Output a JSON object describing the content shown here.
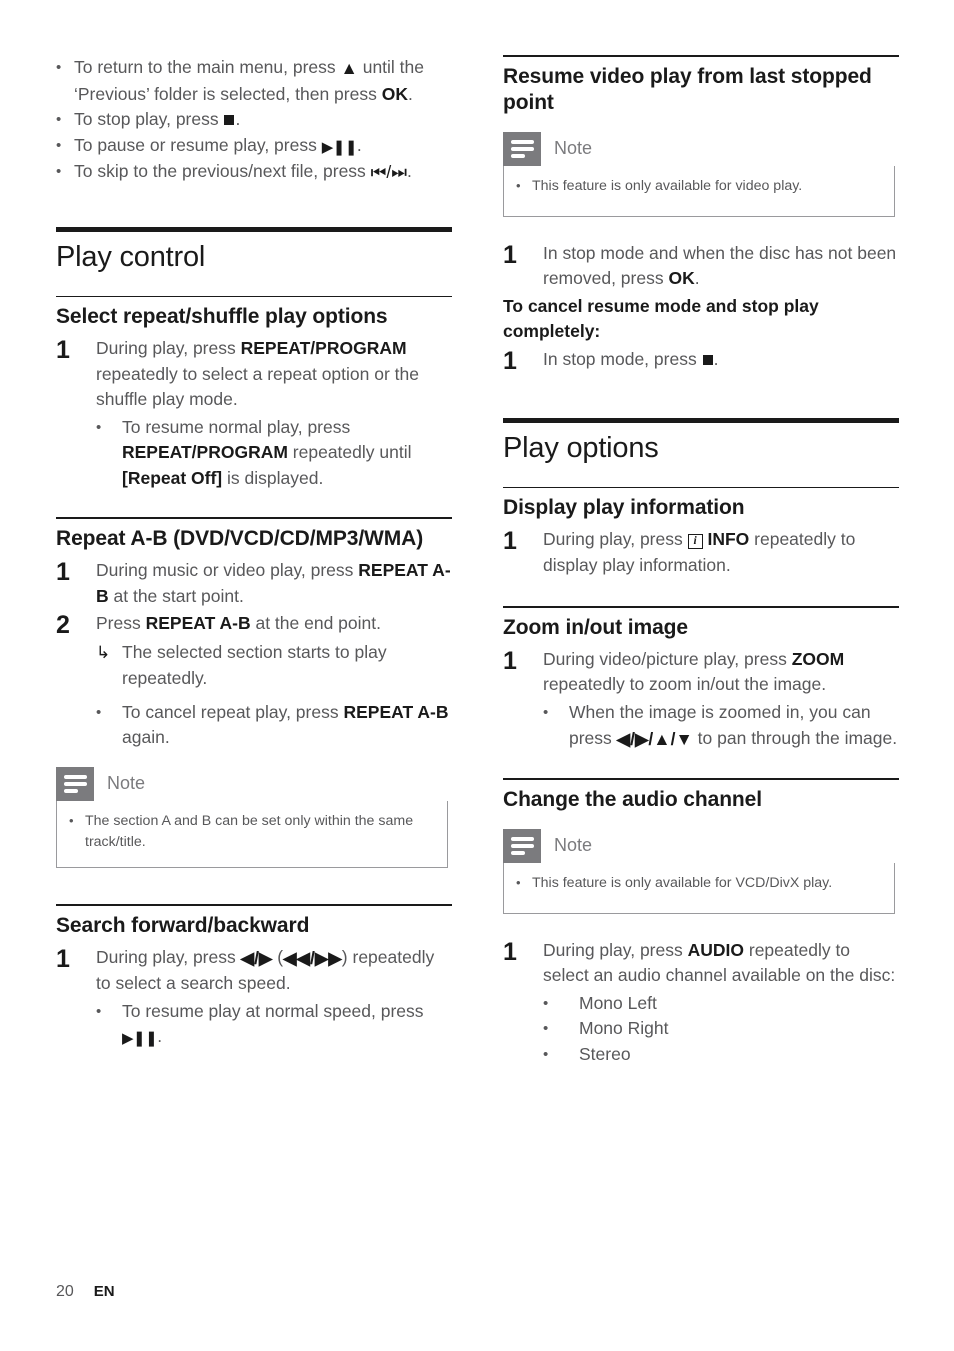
{
  "document": {
    "footer": {
      "page_number": "20",
      "language": "EN"
    },
    "note_label": "Note"
  },
  "left_column": {
    "intro_bullets": [
      {
        "prefix": "To return to the main menu, press ",
        "glyph": "up-arrow",
        "mid": " until the ‘Previous’ folder is selected, then press ",
        "bold": "OK",
        "suffix": "."
      },
      {
        "prefix": "To stop play, press ",
        "glyph": "stop",
        "suffix": "."
      },
      {
        "prefix": "To pause or resume play, press ",
        "glyph": "play-pause",
        "suffix": "."
      },
      {
        "prefix": "To skip to the previous/next file, press ",
        "glyph": "prev-next",
        "suffix": "."
      }
    ],
    "section": {
      "title": "Play control"
    },
    "sub_repeat_shuffle": {
      "title": "Select repeat/shuffle play options",
      "step_number": "1",
      "step_text_pre": "During play, press ",
      "step_bold": "REPEAT/PROGRAM",
      "step_text_post": " repeatedly to select a repeat option or the shuffle play mode.",
      "bullet_pre": "To resume normal play, press ",
      "bullet_bold": "REPEAT/PROGRAM",
      "bullet_mid": " repeatedly until ",
      "bullet_bold2": "[Repeat Off]",
      "bullet_post": " is displayed."
    },
    "sub_repeat_ab": {
      "title": "Repeat A-B (DVD/VCD/CD/MP3/WMA)",
      "step1_number": "1",
      "step1_pre": "During music or video play, press ",
      "step1_bold": "REPEAT A-B",
      "step1_post": " at the start point.",
      "step2_number": "2",
      "step2_pre": "Press ",
      "step2_bold": "REPEAT A-B",
      "step2_post": " at the end point.",
      "result": "The selected section starts to play repeatedly.",
      "bullet_pre": "To cancel repeat play, press ",
      "bullet_bold": "REPEAT A-B",
      "bullet_post": " again.",
      "note_bullet": "The section A and B can be set only within the same track/title."
    },
    "sub_search": {
      "title": "Search forward/backward",
      "step_number": "1",
      "step_pre": "During play, press ",
      "step_glyph1": "◀/▶",
      "step_mid": " (",
      "step_glyph2": "◀◀/▶▶",
      "step_post": ") repeatedly to select a search speed.",
      "bullet_pre": "To resume play at normal speed, press ",
      "bullet_glyph": "play-pause",
      "bullet_post": "."
    }
  },
  "right_column": {
    "sub_resume": {
      "title": "Resume video play from last stopped point",
      "note_bullet": "This feature is only available for video play.",
      "step1_number": "1",
      "step1_pre": "In stop mode and when the disc has not been removed, press ",
      "step1_bold": "OK",
      "step1_post": ".",
      "cancel_heading": "To cancel resume mode and stop play completely:",
      "step2_number": "1",
      "step2_pre": "In stop mode, press ",
      "step2_glyph": "stop",
      "step2_post": "."
    },
    "section": {
      "title": "Play options"
    },
    "sub_display_info": {
      "title": "Display play information",
      "step_number": "1",
      "step_pre": "During play, press ",
      "step_icon": "info-icon",
      "step_bold": "INFO",
      "step_post": " repeatedly to display play information."
    },
    "sub_zoom": {
      "title": "Zoom in/out image",
      "step_number": "1",
      "step_pre": "During video/picture play, press ",
      "step_bold": "ZOOM",
      "step_post": " repeatedly to zoom in/out the image.",
      "bullet_pre": "When the image is zoomed in, you can press ",
      "bullet_glyph": "◀/▶/▲/▼",
      "bullet_post": " to pan through the image."
    },
    "sub_audio": {
      "title": "Change the audio channel",
      "note_bullet": "This feature is only available for VCD/DivX play.",
      "step_number": "1",
      "step_pre": "During play, press ",
      "step_bold": "AUDIO",
      "step_post": " repeatedly to select an audio channel available on the disc:",
      "options": [
        "Mono Left",
        "Mono Right",
        "Stereo"
      ]
    }
  }
}
